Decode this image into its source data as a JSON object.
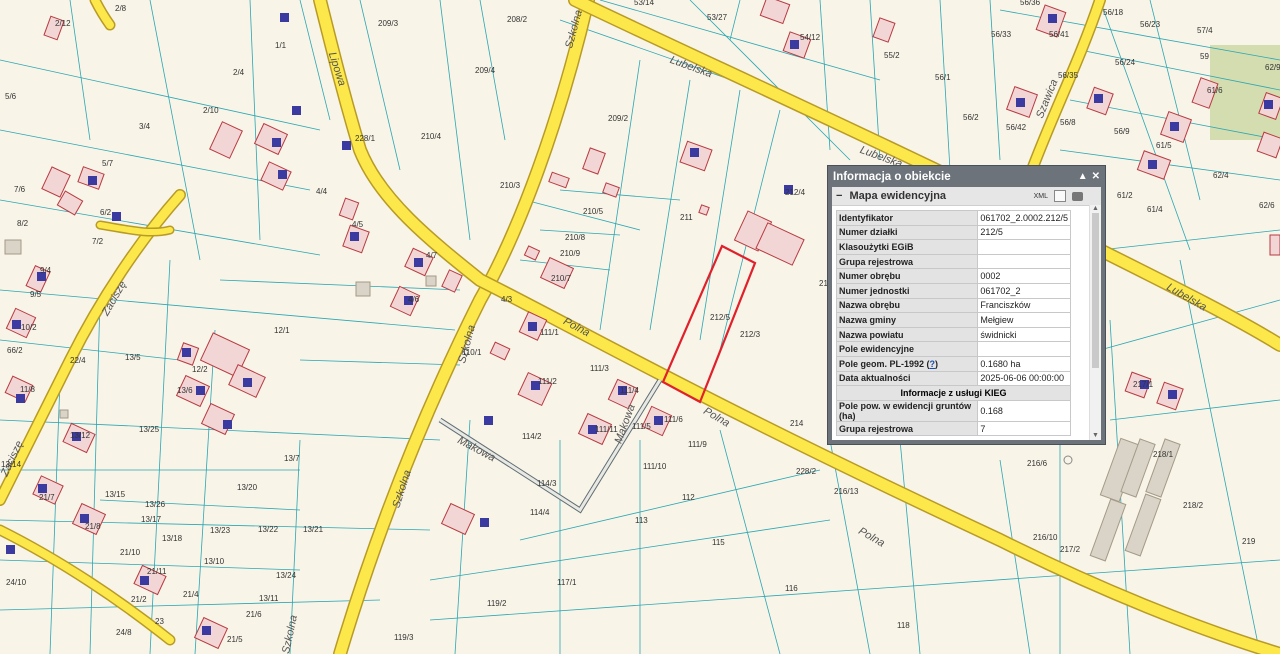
{
  "map": {
    "roads": [
      {
        "name": "Szkolna"
      },
      {
        "name": "Lipowa"
      },
      {
        "name": "Lubelska"
      },
      {
        "name": "Polna"
      },
      {
        "name": "Szawica"
      },
      {
        "name": "Zaciszę"
      },
      {
        "name": "Makowa"
      },
      {
        "name": "Makowa"
      }
    ],
    "parcel_labels": [
      "2/12",
      "2/8",
      "1/1",
      "209/3",
      "208/2",
      "53/14",
      "53/27",
      "54/12",
      "55/2",
      "56/36",
      "56/41",
      "56/18",
      "56/23",
      "57/4",
      "2/4",
      "209/4",
      "56/33",
      "56/24",
      "56/35",
      "59",
      "62/9",
      "5/6",
      "2/10",
      "3/4",
      "228/1",
      "209/2",
      "210/4",
      "56/1",
      "56/2",
      "56/42",
      "56/8",
      "56/9",
      "61/6",
      "62/4",
      "5/7",
      "7/6",
      "6/2",
      "4/4",
      "210/3",
      "210/5",
      "211",
      "212/4",
      "61/5",
      "61/2",
      "61/4",
      "62/6",
      "8/2",
      "7/2",
      "4/5",
      "210/8",
      "210/9",
      "210/7",
      "4/7",
      "9/4",
      "9/5",
      "4/6",
      "4/3",
      "213",
      "10/2",
      "66/2",
      "12/1",
      "111/1",
      "212/5",
      "212/3",
      "22/4",
      "13/5",
      "12/2",
      "110/1",
      "111/3",
      "111/2",
      "111/4",
      "13/6",
      "11/8",
      "13/25",
      "111/11",
      "111/5",
      "111/6",
      "114/2",
      "111/9",
      "214",
      "217/1",
      "13/12",
      "13/14",
      "13/7",
      "111/10",
      "218/1",
      "216/6",
      "21/7",
      "13/15",
      "13/26",
      "13/20",
      "114/3",
      "112",
      "228/2",
      "216/13",
      "21/8",
      "13/17",
      "114/4",
      "113",
      "218/2",
      "13/18",
      "13/23",
      "13/22",
      "13/21",
      "115",
      "216/10",
      "219",
      "21/10",
      "13/10",
      "21/11",
      "13/24",
      "117/1",
      "217/2",
      "21/2",
      "21/4",
      "13/11",
      "21/6",
      "119/2",
      "116",
      "24/10",
      "23",
      "24/8",
      "21/5",
      "119/3",
      "118"
    ]
  },
  "panel": {
    "title": "Informacja o obiekcie",
    "section_title": "Mapa ewidencyjna",
    "xml_label": "XML",
    "rows": [
      {
        "key": "Identyfikator",
        "value": "061702_2.0002.212/5"
      },
      {
        "key": "Numer działki",
        "value": "212/5"
      },
      {
        "key": "Klasoużytki EGiB",
        "value": ""
      },
      {
        "key": "Grupa rejestrowa",
        "value": ""
      },
      {
        "key": "Numer obrębu",
        "value": "0002"
      },
      {
        "key": "Numer jednostki",
        "value": "061702_2"
      },
      {
        "key": "Nazwa obrębu",
        "value": "Franciszków"
      },
      {
        "key": "Nazwa gminy",
        "value": "Mełgiew"
      },
      {
        "key": "Nazwa powiatu",
        "value": "świdnicki"
      },
      {
        "key": "Pole ewidencyjne",
        "value": ""
      },
      {
        "key": "Pole geom. PL-1992",
        "link": "?",
        "value": "0.1680 ha"
      },
      {
        "key": "Data aktualności",
        "value": "2025-06-06 00:00:00"
      }
    ],
    "kieg_header": "Informacje z usługi KIEG",
    "rows2": [
      {
        "key": "Pole pow. w ewidencji gruntów (ha)",
        "value": "0.168"
      },
      {
        "key": "Grupa rejestrowa",
        "value": "7"
      }
    ]
  }
}
